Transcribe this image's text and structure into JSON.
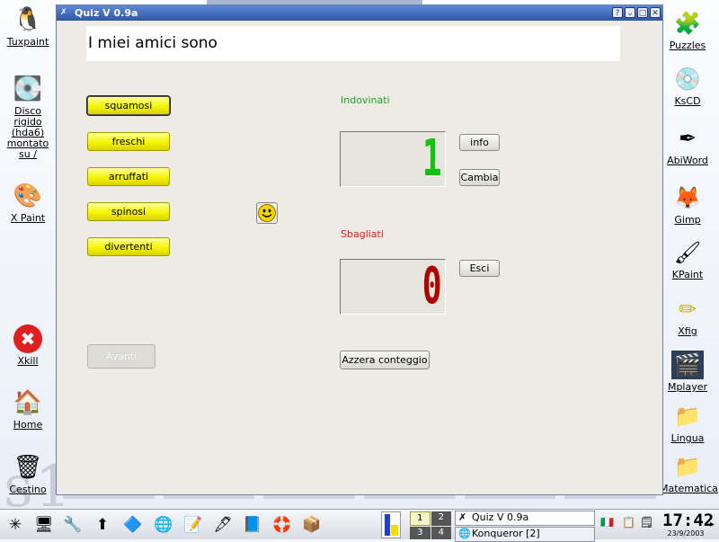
{
  "desktop": {
    "left_icons": [
      {
        "label": "Tuxpaint",
        "icon": "tuxpaint-icon",
        "glyph": "🐧"
      },
      {
        "label": "Disco rigido (hda6) montato su /",
        "icon": "harddisk-icon",
        "glyph": "💽"
      },
      {
        "label": "X Paint",
        "icon": "palette-icon",
        "glyph": "🎨"
      },
      {
        "label": "Xkill",
        "icon": "xkill-icon",
        "glyph": "✖"
      },
      {
        "label": "Home",
        "icon": "home-icon",
        "glyph": "🏠"
      },
      {
        "label": "Cestino",
        "icon": "trash-icon",
        "glyph": "🗑"
      }
    ],
    "right_icons": [
      {
        "label": "Puzzles",
        "icon": "puzzles-icon",
        "glyph": "🧩"
      },
      {
        "label": "KsCD",
        "icon": "kscd-icon",
        "glyph": "💿"
      },
      {
        "label": "AbiWord",
        "icon": "abiword-icon",
        "glyph": "✒"
      },
      {
        "label": "Gimp",
        "icon": "gimp-icon",
        "glyph": "🦊"
      },
      {
        "label": "KPaint",
        "icon": "kpaint-icon",
        "glyph": "🖌"
      },
      {
        "label": "Xfig",
        "icon": "xfig-icon",
        "glyph": "✏"
      },
      {
        "label": "Mplayer",
        "icon": "mplayer-icon",
        "glyph": "🎬"
      },
      {
        "label": "Lingua",
        "icon": "lingua-icon",
        "glyph": "📁"
      },
      {
        "label": "Matematica",
        "icon": "matematica-icon",
        "glyph": "📁"
      }
    ]
  },
  "window": {
    "title": "Quiz V 0.9a",
    "buttons": {
      "help": "?",
      "shade": "⌄",
      "maximize": "□",
      "close": "✕"
    },
    "question": "I miei amici sono",
    "answers": [
      {
        "label": "squamosi",
        "focused": true
      },
      {
        "label": "freschi",
        "focused": false
      },
      {
        "label": "arruffati",
        "focused": false
      },
      {
        "label": "spinosi",
        "focused": false
      },
      {
        "label": "divertenti",
        "focused": false
      }
    ],
    "next_button": "Avanti",
    "correct_label": "Indovinati",
    "correct_count": "1",
    "wrong_label": "Sbagliati",
    "wrong_count": "0",
    "info_button": "info",
    "change_button": "Cambia",
    "exit_button": "Esci",
    "reset_button": "Azzera conteggio",
    "colors": {
      "correct": "#1f9f1f",
      "wrong": "#e02020",
      "button": "#f5f500",
      "lcd_correct": "#15c015",
      "lcd_wrong": "#b00000"
    }
  },
  "taskbar": {
    "launchers": [
      {
        "icon": "kde-menu-icon",
        "glyph": "✳"
      },
      {
        "icon": "desktop-icon",
        "glyph": "🖥"
      },
      {
        "icon": "tools-icon",
        "glyph": "🔧"
      },
      {
        "icon": "updates-icon",
        "glyph": "⬆"
      },
      {
        "icon": "cube-icon",
        "glyph": "🔷"
      },
      {
        "icon": "konqueror-icon",
        "glyph": "🌐"
      },
      {
        "icon": "editor-icon",
        "glyph": "📝"
      },
      {
        "icon": "pen-icon",
        "glyph": "🖋"
      },
      {
        "icon": "terminal-icon",
        "glyph": "📘"
      },
      {
        "icon": "lifebuoy-icon",
        "glyph": "🛟"
      },
      {
        "icon": "package-icon",
        "glyph": "📦"
      }
    ],
    "pager": [
      "1",
      "2",
      "3",
      "4"
    ],
    "tasks": [
      "Quiz V 0.9a",
      "Konqueror [2]"
    ],
    "clock_time": "17:42",
    "clock_date": "23/9/2003"
  }
}
